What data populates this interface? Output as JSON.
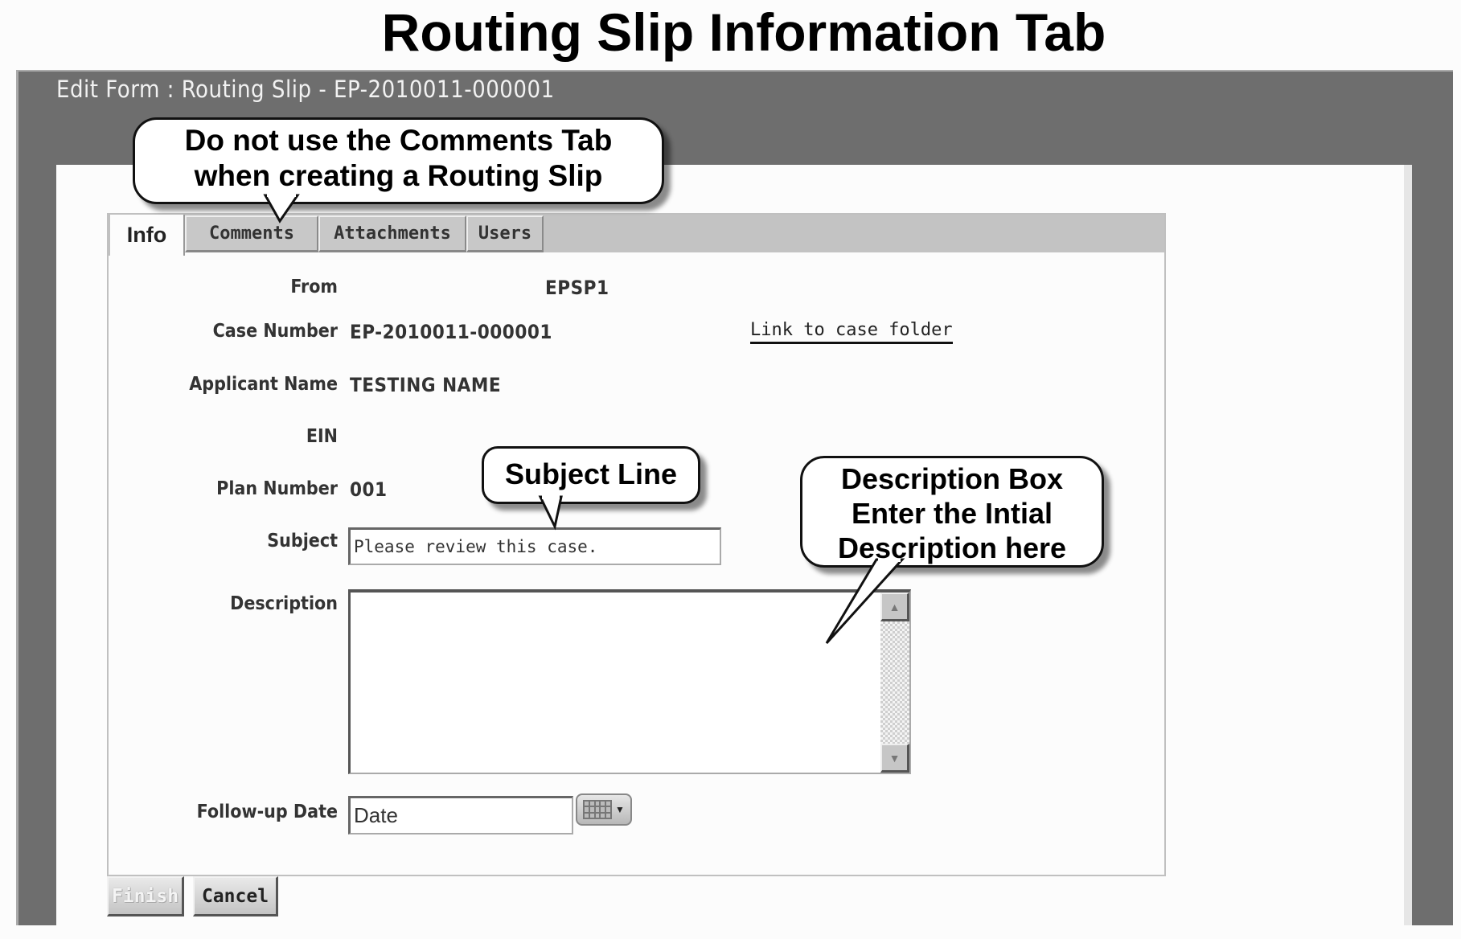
{
  "page_title": "Routing Slip Information Tab",
  "window": {
    "title": "Edit Form :  Routing Slip - EP-2010011-000001"
  },
  "tabs": [
    {
      "label": "Info",
      "active": true
    },
    {
      "label": "Comments",
      "active": false
    },
    {
      "label": "Attachments",
      "active": false
    },
    {
      "label": "Users",
      "active": false
    }
  ],
  "form": {
    "from": {
      "label": "From",
      "value": "EPSP1"
    },
    "case_number": {
      "label": "Case Number",
      "value": "EP-2010011-000001",
      "link_label": "Link to case folder"
    },
    "applicant_name": {
      "label": "Applicant Name",
      "value": "TESTING NAME"
    },
    "ein": {
      "label": "EIN",
      "value": ""
    },
    "plan_number": {
      "label": "Plan Number",
      "value": "001"
    },
    "subject": {
      "label": "Subject",
      "value": "Please review this case."
    },
    "description": {
      "label": "Description",
      "value": ""
    },
    "followup_date": {
      "label": "Follow-up Date",
      "value": "Date",
      "calendar_icon": "calendar-icon"
    }
  },
  "buttons": {
    "finish": "Finish",
    "cancel": "Cancel"
  },
  "callouts": {
    "comments": {
      "line1": "Do not use the Comments Tab",
      "line2": "when creating a Routing Slip"
    },
    "subject": {
      "line1": "Subject Line"
    },
    "description": {
      "line1": "Description Box",
      "line2": "Enter the Intial",
      "line3": "Description here"
    }
  },
  "colors": {
    "frame": "#6e6e6e",
    "tab_band": "#c3c3c3",
    "panel_bg": "#fcfcfc"
  }
}
